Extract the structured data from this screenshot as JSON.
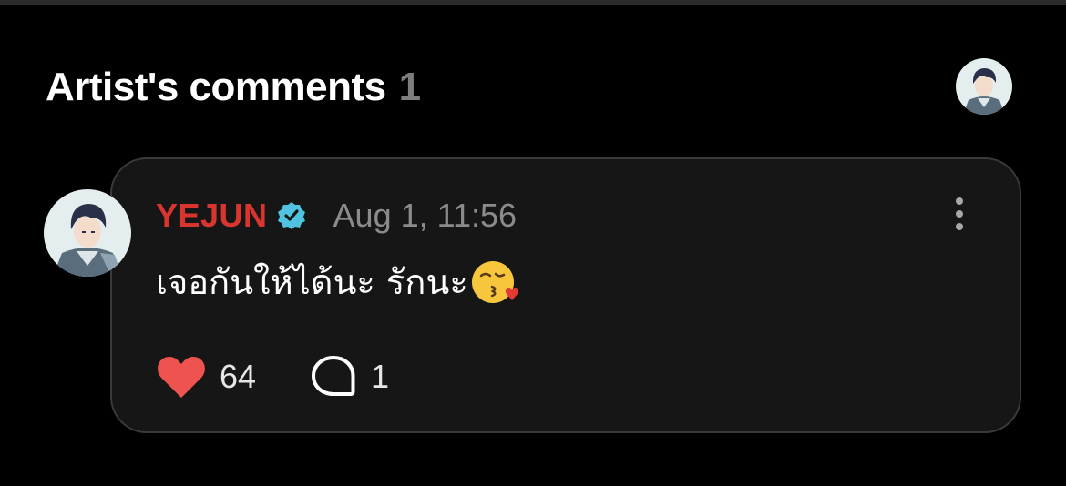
{
  "header": {
    "title": "Artist's comments",
    "count": "1"
  },
  "comment": {
    "author": "YEJUN",
    "timestamp": "Aug 1, 11:56",
    "text": "เจอกันให้ได้นะ รักนะ",
    "emoji": "kissing-face-with-heart-emoji",
    "likes": "64",
    "replies": "1"
  },
  "colors": {
    "background": "#000000",
    "card": "#161616",
    "author": "#d9352f",
    "verified": "#4fc3e0",
    "heart": "#ef5350",
    "muted": "#8b8b8b"
  },
  "icons": {
    "avatar": "artist-avatar",
    "verified": "verified-badge-icon",
    "more": "more-vertical-icon",
    "like": "heart-icon",
    "reply": "speech-bubble-icon"
  }
}
